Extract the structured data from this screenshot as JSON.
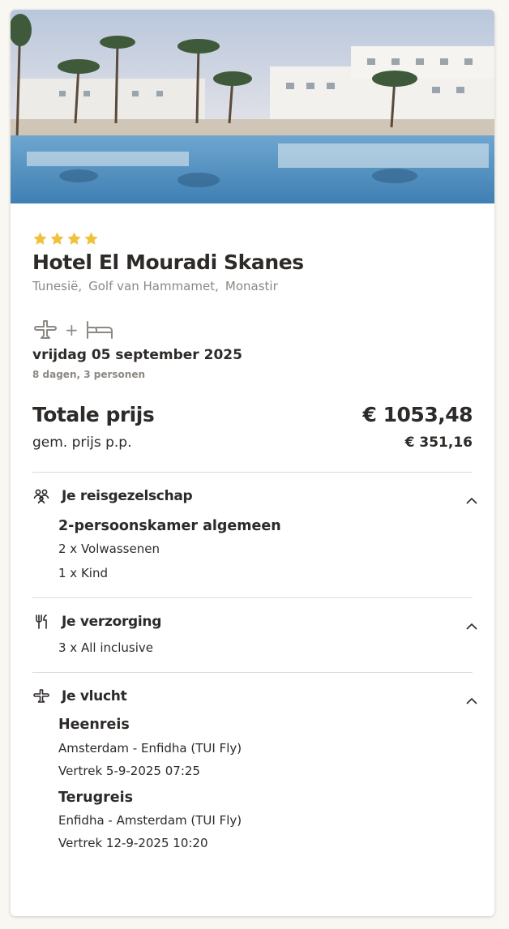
{
  "hotel": {
    "stars": 4,
    "name": "Hotel El Mouradi Skanes",
    "location": [
      "Tunesië",
      "Golf van Hammamet",
      "Monastir"
    ]
  },
  "trip": {
    "date": "vrijdag 05 september 2025",
    "summary": "8 dagen, 3 personen",
    "icons": [
      "plane-icon",
      "plus",
      "bed-icon"
    ],
    "plus": "+"
  },
  "price": {
    "total_label": "Totale prijs",
    "total_value": "€ 1053,48",
    "pp_label": "gem. prijs p.p.",
    "pp_value": "€ 351,16"
  },
  "sections": {
    "party": {
      "title": "Je reisgezelschap",
      "room": "2-persoonskamer algemeen",
      "lines": [
        "2 x Volwassenen",
        "1 x Kind"
      ]
    },
    "board": {
      "title": "Je verzorging",
      "lines": [
        "3 x All inclusive"
      ]
    },
    "flight": {
      "title": "Je vlucht",
      "out_title": "Heenreis",
      "out_route": "Amsterdam - Enfidha (TUI Fly)",
      "out_dep": "Vertrek 5-9-2025 07:25",
      "ret_title": "Terugreis",
      "ret_route": "Enfidha - Amsterdam (TUI Fly)",
      "ret_dep": "Vertrek 12-9-2025 10:20"
    }
  },
  "colors": {
    "star": "#f0c23b",
    "muted": "#8c8883",
    "text": "#2d2a28"
  }
}
